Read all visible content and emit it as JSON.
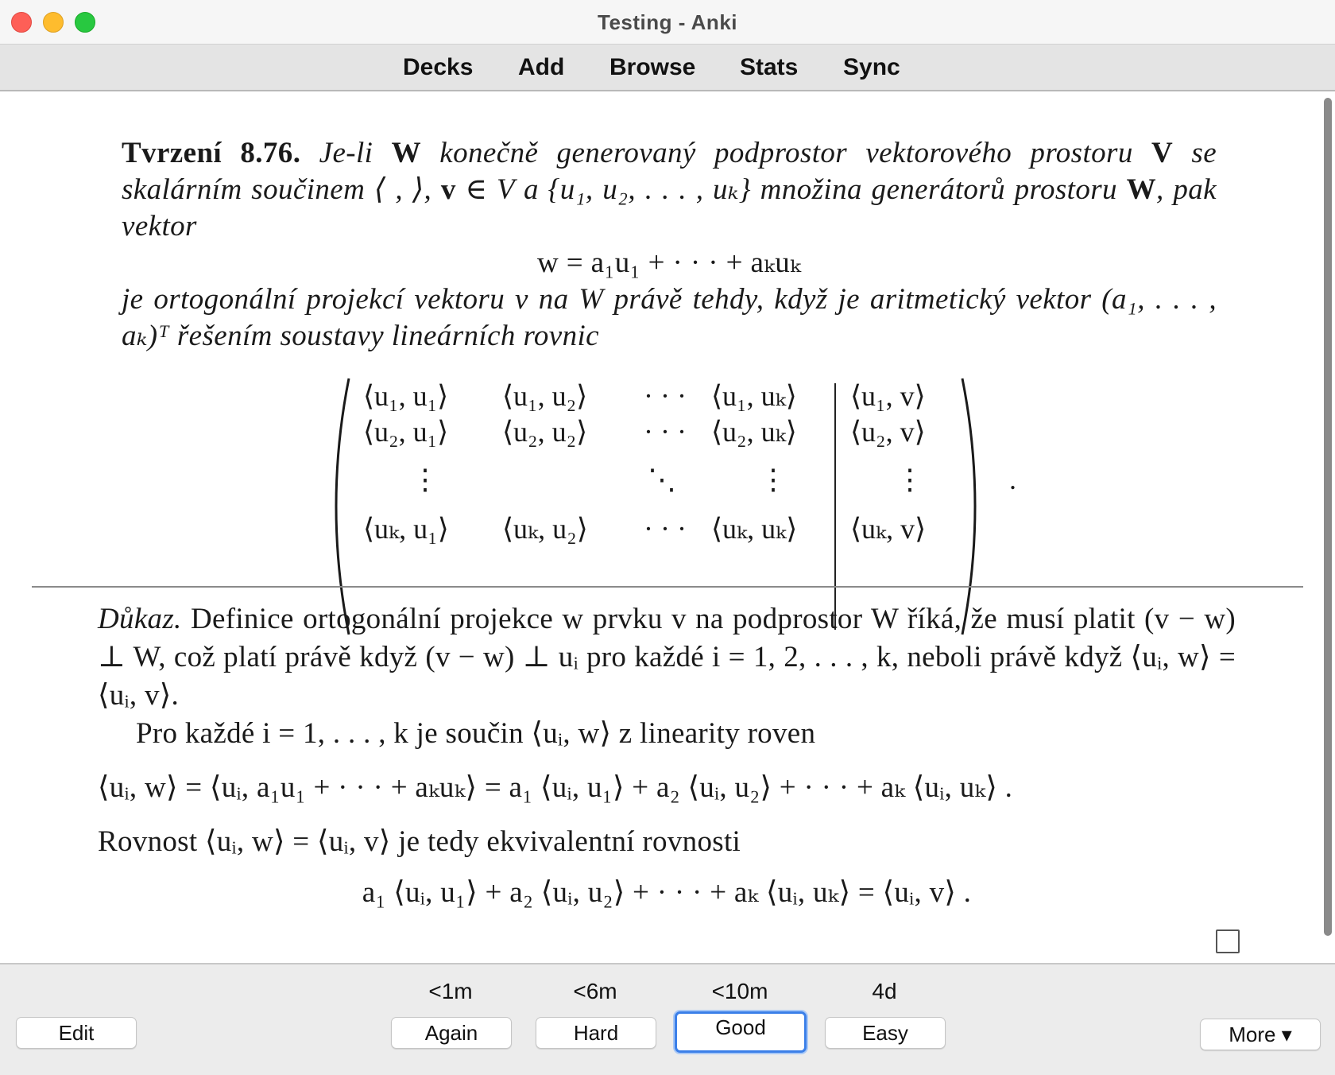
{
  "window": {
    "title": "Testing - Anki"
  },
  "nav": {
    "decks": "Decks",
    "add": "Add",
    "browse": "Browse",
    "stats": "Stats",
    "sync": "Sync"
  },
  "card": {
    "front": {
      "head": "Tvrzení 8.76.",
      "statement_a": "Je-li",
      "W": "W",
      "statement_b": "konečně generovaný podprostor vektorového prostoru",
      "V": "V",
      "statement_c": "se skalárním součinem ⟨ , ⟩,",
      "v": "v",
      "statement_d": "∈ V a {u₁, u₂, . . . , uₖ} množina generátorů prostoru",
      "statement_e": ", pak vektor",
      "equation": "w = a₁u₁ + · · · + aₖuₖ",
      "statement_f": "je ortogonální projekcí vektoru v na W právě tehdy, když je aritmetický vektor (a₁, . . . , aₖ)ᵀ řešením soustavy lineárních rovnic"
    },
    "matrix": {
      "rows": [
        [
          "⟨u₁, u₁⟩",
          "⟨u₁, u₂⟩",
          "· · ·",
          "⟨u₁, uₖ⟩",
          "⟨u₁, v⟩"
        ],
        [
          "⟨u₂, u₁⟩",
          "⟨u₂, u₂⟩",
          "· · ·",
          "⟨u₂, uₖ⟩",
          "⟨u₂, v⟩"
        ],
        [
          "⋮",
          "",
          "⋱",
          "⋮",
          "⋮"
        ],
        [
          "⟨uₖ, u₁⟩",
          "⟨uₖ, u₂⟩",
          "· · ·",
          "⟨uₖ, uₖ⟩",
          "⟨uₖ, v⟩"
        ]
      ],
      "period": "."
    },
    "back": {
      "proof_label": "Důkaz.",
      "p1": "Definice ortogonální projekce w prvku v na podprostor W říká, že musí platit (v − w) ⊥ W, což platí právě když (v − w) ⊥ uᵢ pro každé i = 1, 2, . . . , k, neboli právě když ⟨uᵢ, w⟩ = ⟨uᵢ, v⟩.",
      "p2": "Pro každé i = 1, . . . , k je součin ⟨uᵢ, w⟩ z linearity roven",
      "eq1": "⟨uᵢ, w⟩ = ⟨uᵢ, a₁u₁ + · · · + aₖuₖ⟩ = a₁ ⟨uᵢ, u₁⟩ + a₂ ⟨uᵢ, u₂⟩ + · · · + aₖ ⟨uᵢ, uₖ⟩  .",
      "p3": "Rovnost ⟨uᵢ, w⟩ = ⟨uᵢ, v⟩ je tedy ekvivalentní rovnosti",
      "eq2": "a₁ ⟨uᵢ, u₁⟩ + a₂ ⟨uᵢ, u₂⟩ + · · · + aₖ ⟨uᵢ, uₖ⟩ = ⟨uᵢ, v⟩  ."
    }
  },
  "answers": {
    "edit": "Edit",
    "again": {
      "interval": "<1m",
      "label": "Again"
    },
    "hard": {
      "interval": "<6m",
      "label": "Hard"
    },
    "good": {
      "interval": "<10m",
      "label": "Good"
    },
    "easy": {
      "interval": "4d",
      "label": "Easy"
    },
    "more": "More ▾"
  },
  "colors": {
    "accent": "#3b7fe8",
    "close": "#fe5f57",
    "minimize": "#febc2e",
    "maximize": "#28c840"
  }
}
